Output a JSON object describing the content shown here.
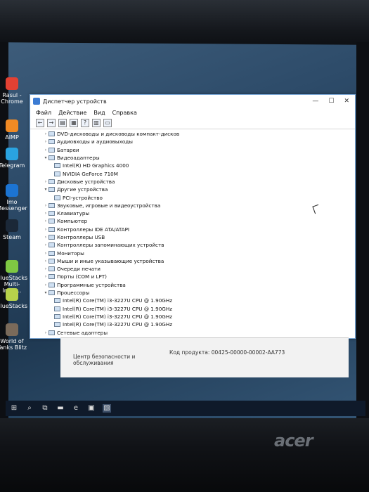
{
  "desktop": {
    "icons": [
      {
        "label": "Rasul - Chrome",
        "icon": "chrome-icon",
        "color": "#e34133"
      },
      {
        "label": "AIMP",
        "icon": "aimp-icon",
        "color": "#f08a24"
      },
      {
        "label": "Telegram",
        "icon": "telegram-icon",
        "color": "#2aa3e0"
      },
      {
        "label": "Imo Messenger",
        "icon": "imo-icon",
        "color": "#1c74d3"
      },
      {
        "label": "Steam",
        "icon": "steam-icon",
        "color": "#1b2838"
      },
      {
        "label": "BlueStacks Multi-Insta...",
        "icon": "bluestacks-icon",
        "color": "#7ec843"
      },
      {
        "label": "BlueStacks",
        "icon": "bluestacks-icon",
        "color": "#b7d24b"
      },
      {
        "label": "World of Tanks Blitz",
        "icon": "wot-icon",
        "color": "#7a6a5a"
      }
    ]
  },
  "window": {
    "title": "Диспетчер устройств",
    "menu": [
      "Файл",
      "Действие",
      "Вид",
      "Справка"
    ],
    "toolbar_icons": [
      "back-arrow-icon",
      "forward-arrow-icon",
      "properties-icon",
      "tree-icon",
      "help-icon",
      "view-icon",
      "monitor-icon"
    ],
    "controls": [
      "—",
      "☐",
      "✕"
    ]
  },
  "tree": [
    {
      "label": "DVD-дисководы и дисководы компакт-дисков",
      "level": 1,
      "expanded": false
    },
    {
      "label": "Аудиовходы и аудиовыходы",
      "level": 1,
      "expanded": false
    },
    {
      "label": "Батареи",
      "level": 1,
      "expanded": false
    },
    {
      "label": "Видеоадаптеры",
      "level": 1,
      "expanded": true
    },
    {
      "label": "Intel(R) HD Graphics 4000",
      "level": 2
    },
    {
      "label": "NVIDIA GeForce 710M",
      "level": 2
    },
    {
      "label": "Дисковые устройства",
      "level": 1,
      "expanded": false
    },
    {
      "label": "Другие устройства",
      "level": 1,
      "expanded": true
    },
    {
      "label": "PCI-устройство",
      "level": 2
    },
    {
      "label": "Звуковые, игровые и видеоустройства",
      "level": 1,
      "expanded": false
    },
    {
      "label": "Клавиатуры",
      "level": 1,
      "expanded": false
    },
    {
      "label": "Компьютер",
      "level": 1,
      "expanded": false
    },
    {
      "label": "Контроллеры IDE ATA/ATAPI",
      "level": 1,
      "expanded": false
    },
    {
      "label": "Контроллеры USB",
      "level": 1,
      "expanded": false
    },
    {
      "label": "Контроллеры запоминающих устройств",
      "level": 1,
      "expanded": false
    },
    {
      "label": "Мониторы",
      "level": 1,
      "expanded": false
    },
    {
      "label": "Мыши и иные указывающие устройства",
      "level": 1,
      "expanded": false
    },
    {
      "label": "Очереди печати",
      "level": 1,
      "expanded": false
    },
    {
      "label": "Порты (COM и LPT)",
      "level": 1,
      "expanded": false
    },
    {
      "label": "Программные устройства",
      "level": 1,
      "expanded": false
    },
    {
      "label": "Процессоры",
      "level": 1,
      "expanded": true
    },
    {
      "label": "Intel(R) Core(TM) i3-3227U CPU @ 1.90GHz",
      "level": 2
    },
    {
      "label": "Intel(R) Core(TM) i3-3227U CPU @ 1.90GHz",
      "level": 2
    },
    {
      "label": "Intel(R) Core(TM) i3-3227U CPU @ 1.90GHz",
      "level": 2
    },
    {
      "label": "Intel(R) Core(TM) i3-3227U CPU @ 1.90GHz",
      "level": 2
    },
    {
      "label": "Сетевые адаптеры",
      "level": 1,
      "expanded": false
    }
  ],
  "background_window": {
    "product_code": "Код продукта: 00425-00000-00002-AA773",
    "security_link": "Центр безопасности и обслуживания"
  },
  "taskbar": {
    "icons": [
      "windows-start-icon",
      "search-icon",
      "task-view-icon",
      "file-explorer-icon",
      "edge-icon",
      "store-icon",
      "device-manager-icon"
    ]
  },
  "brand": "acer"
}
